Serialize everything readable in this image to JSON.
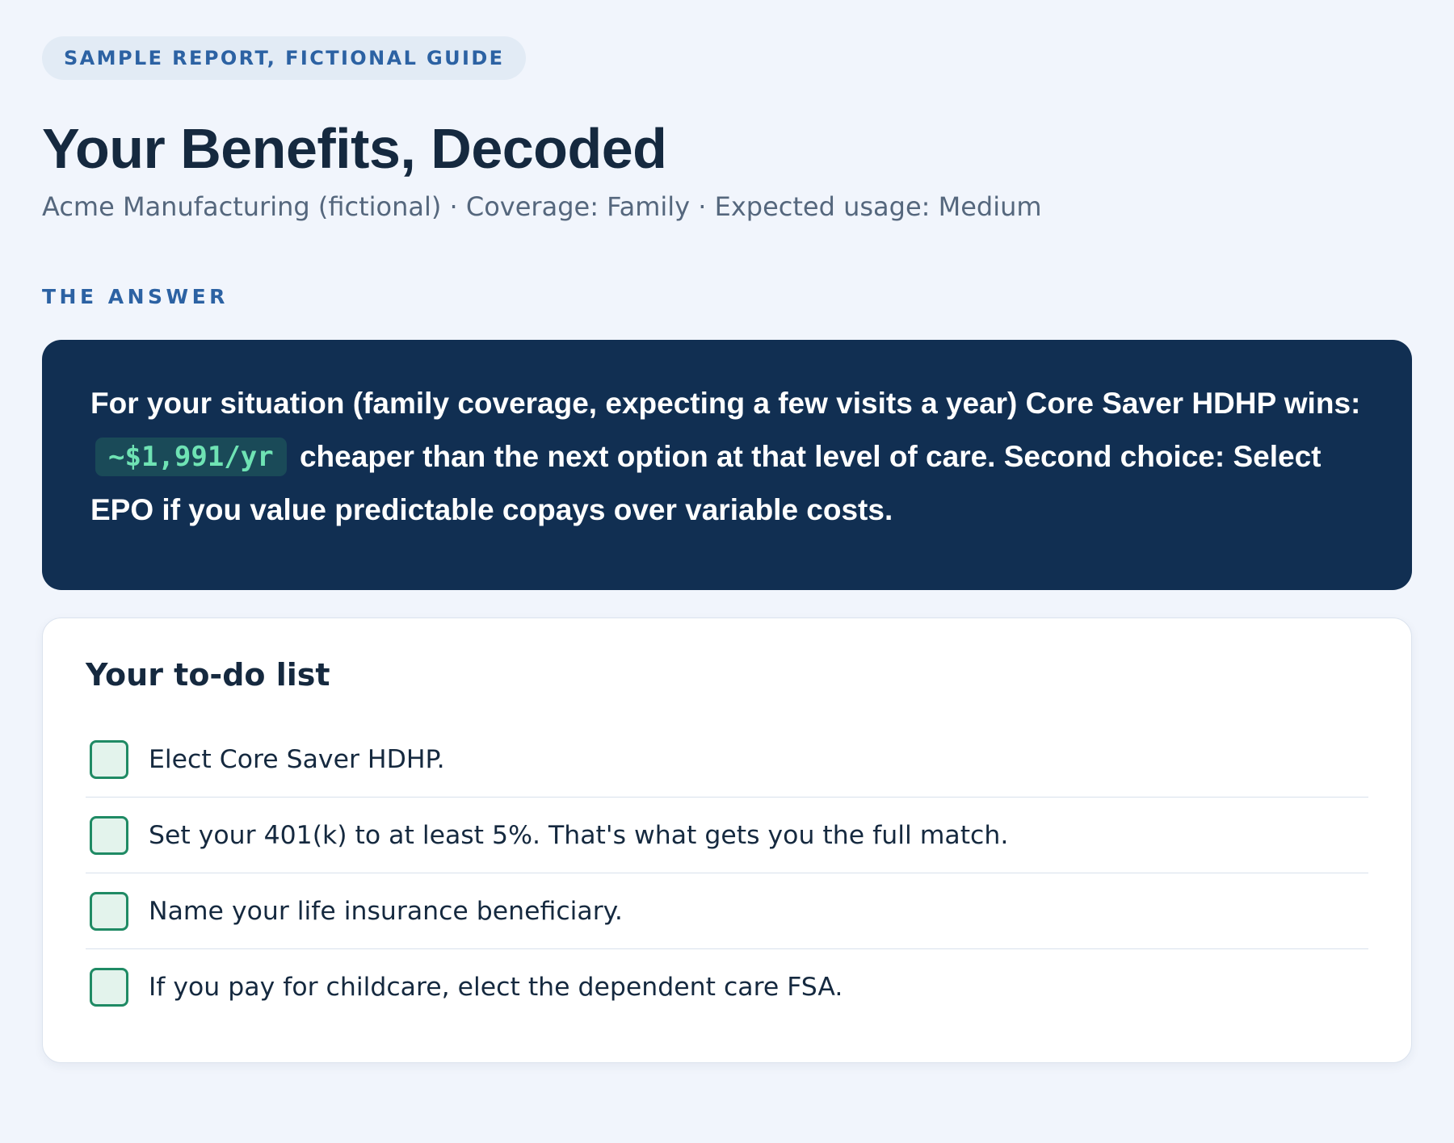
{
  "badge": "SAMPLE REPORT, FICTIONAL GUIDE",
  "title": "Your Benefits, Decoded",
  "subtitle": "Acme Manufacturing (fictional) · Coverage: Family · Expected usage: Medium",
  "section_label": "THE ANSWER",
  "answer": {
    "text_before": "For your situation (family coverage, expecting a few visits a year) Core Saver HDHP wins:",
    "highlight": "~$1,991/yr",
    "text_after": "cheaper than the next option at that level of care. Second choice: Select EPO if you value predictable copays over variable costs."
  },
  "todo": {
    "title": "Your to-do list",
    "items": [
      "Elect Core Saver HDHP.",
      "Set your 401(k) to at least 5%. That's what gets you the full match.",
      "Name your life insurance beneficiary.",
      "If you pay for childcare, elect the dependent care FSA."
    ]
  },
  "colors": {
    "background": "#f1f5fc",
    "accent_blue": "#2c62a3",
    "answer_bg": "#112f52",
    "highlight_text": "#6fe3b4",
    "checkbox_border": "#1f8a64"
  }
}
